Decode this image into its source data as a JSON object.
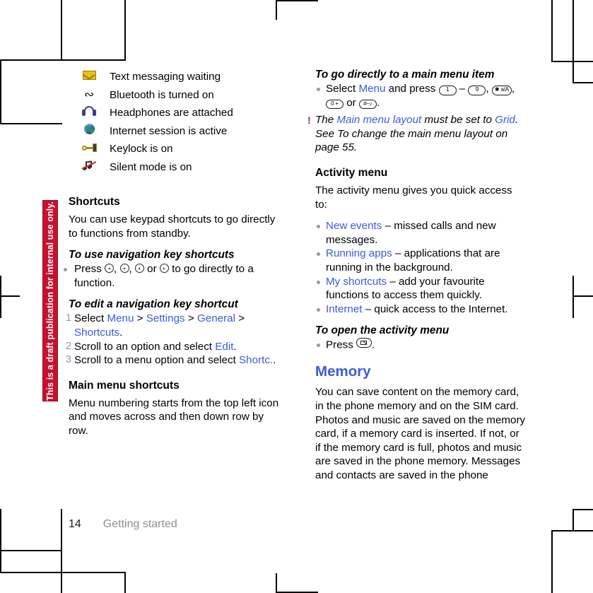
{
  "document": {
    "watermark": "This is a draft publication for internal use only.",
    "footer": {
      "page_number": "14",
      "section": "Getting started"
    }
  },
  "left_column": {
    "status_icons": [
      {
        "icon": "envelope-icon",
        "label": "Text messaging waiting"
      },
      {
        "icon": "bluetooth-icon",
        "label": "Bluetooth is turned on"
      },
      {
        "icon": "headphones-icon",
        "label": "Headphones are attached"
      },
      {
        "icon": "globe-icon",
        "label": "Internet session is active"
      },
      {
        "icon": "key-icon",
        "label": "Keylock is on"
      },
      {
        "icon": "silent-mode-icon",
        "label": "Silent mode is on"
      }
    ],
    "shortcuts": {
      "heading": "Shortcuts",
      "intro": "You can use keypad shortcuts to go directly to functions from standby.",
      "use_nav_heading": "To use navigation key shortcuts",
      "use_nav_bullet_pre": "Press ",
      "use_nav_bullet_mid1": ", ",
      "use_nav_bullet_mid2": ", ",
      "use_nav_bullet_or": " or ",
      "use_nav_bullet_post": " to go directly to a function.",
      "edit_nav_heading": "To edit a navigation key shortcut",
      "steps": [
        {
          "n": "1",
          "pre": "Select ",
          "link1": "Menu",
          "sep1": " > ",
          "link2": "Settings",
          "sep2": " > ",
          "link3": "General",
          "sep3": " > ",
          "link4": "Shortcuts",
          "post": "."
        },
        {
          "n": "2",
          "pre": "Scroll to an option and select ",
          "link1": "Edit",
          "post": "."
        },
        {
          "n": "3",
          "pre": "Scroll to a menu option and select ",
          "link1": "Shortc.",
          "post": "."
        }
      ],
      "main_menu_heading": "Main menu shortcuts",
      "main_menu_text": "Menu numbering starts from the top left icon and moves across and then down row by row."
    }
  },
  "right_column": {
    "go_directly": {
      "heading": "To go directly to a main menu item",
      "bullet_pre": "Select ",
      "bullet_link": "Menu",
      "bullet_mid": " and press ",
      "key_1": "1",
      "dash": " – ",
      "key_9": "9",
      "comma1": ", ",
      "key_star": "✱ a/A",
      "comma2": ", ",
      "key_0": "0 +",
      "or": " or ",
      "key_hash": "#–♪",
      "period": "."
    },
    "note": {
      "icon": "warning-icon",
      "pre": "The ",
      "link1": "Main menu layout",
      "mid": " must be set to ",
      "link2": "Grid",
      "post": ". See To change the main menu layout on page 55."
    },
    "activity_menu": {
      "heading": "Activity menu",
      "intro": "The activity menu gives you quick access to:",
      "items": [
        {
          "link": "New events",
          "text": " – missed calls and new messages."
        },
        {
          "link": "Running apps",
          "text": " – applications that are running in the background."
        },
        {
          "link": "My shortcuts",
          "text": " – add your favourite functions to access them quickly."
        },
        {
          "link": "Internet",
          "text": " – quick access to the Internet."
        }
      ],
      "open_heading": "To open the activity menu",
      "open_bullet_pre": "Press ",
      "open_bullet_post": "."
    },
    "memory": {
      "heading": "Memory",
      "text": "You can save content on the memory card, in the phone memory and on the SIM card. Photos and music are saved on the memory card, if a memory card is inserted. If not, or if the memory card is full, photos and music are saved in the phone memory. Messages and contacts are saved in the phone"
    }
  },
  "colors": {
    "link_blue": "#3b5bdb",
    "watermark_red": "#c8102e",
    "bullet_grey": "#8d9bb5",
    "footer_grey": "#8e8e8e"
  }
}
